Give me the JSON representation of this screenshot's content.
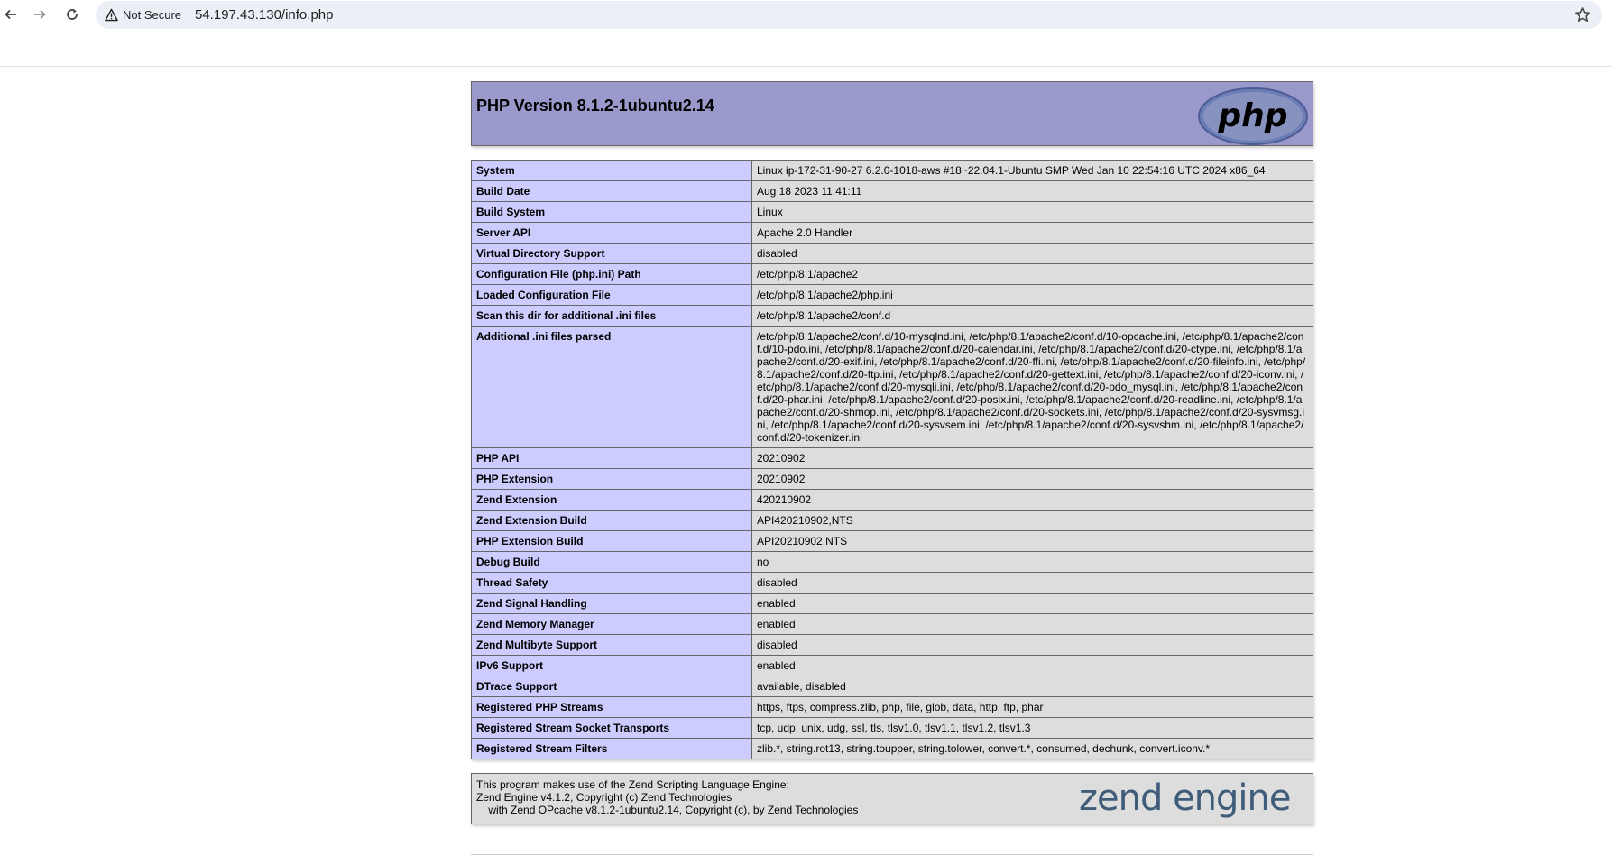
{
  "browser": {
    "security_label": "Not Secure",
    "url": "54.197.43.130/info.php",
    "icons": {
      "back": "arrow-left-icon",
      "forward": "arrow-right-icon",
      "reload": "reload-icon",
      "warning": "warning-triangle-icon",
      "bookmark": "star-icon"
    }
  },
  "header": {
    "title": "PHP Version 8.1.2-1ubuntu2.14",
    "logo_text": "php"
  },
  "info_rows": [
    {
      "label": "System",
      "value": "Linux ip-172-31-90-27 6.2.0-1018-aws #18~22.04.1-Ubuntu SMP Wed Jan 10 22:54:16 UTC 2024 x86_64"
    },
    {
      "label": "Build Date",
      "value": "Aug 18 2023 11:41:11"
    },
    {
      "label": "Build System",
      "value": "Linux"
    },
    {
      "label": "Server API",
      "value": "Apache 2.0 Handler"
    },
    {
      "label": "Virtual Directory Support",
      "value": "disabled"
    },
    {
      "label": "Configuration File (php.ini) Path",
      "value": "/etc/php/8.1/apache2"
    },
    {
      "label": "Loaded Configuration File",
      "value": "/etc/php/8.1/apache2/php.ini"
    },
    {
      "label": "Scan this dir for additional .ini files",
      "value": "/etc/php/8.1/apache2/conf.d"
    },
    {
      "label": "Additional .ini files parsed",
      "value": "/etc/php/8.1/apache2/conf.d/10-mysqlnd.ini, /etc/php/8.1/apache2/conf.d/10-opcache.ini, /etc/php/8.1/apache2/conf.d/10-pdo.ini, /etc/php/8.1/apache2/conf.d/20-calendar.ini, /etc/php/8.1/apache2/conf.d/20-ctype.ini, /etc/php/8.1/apache2/conf.d/20-exif.ini, /etc/php/8.1/apache2/conf.d/20-ffi.ini, /etc/php/8.1/apache2/conf.d/20-fileinfo.ini, /etc/php/8.1/apache2/conf.d/20-ftp.ini, /etc/php/8.1/apache2/conf.d/20-gettext.ini, /etc/php/8.1/apache2/conf.d/20-iconv.ini, /etc/php/8.1/apache2/conf.d/20-mysqli.ini, /etc/php/8.1/apache2/conf.d/20-pdo_mysql.ini, /etc/php/8.1/apache2/conf.d/20-phar.ini, /etc/php/8.1/apache2/conf.d/20-posix.ini, /etc/php/8.1/apache2/conf.d/20-readline.ini, /etc/php/8.1/apache2/conf.d/20-shmop.ini, /etc/php/8.1/apache2/conf.d/20-sockets.ini, /etc/php/8.1/apache2/conf.d/20-sysvmsg.ini, /etc/php/8.1/apache2/conf.d/20-sysvsem.ini, /etc/php/8.1/apache2/conf.d/20-sysvshm.ini, /etc/php/8.1/apache2/conf.d/20-tokenizer.ini"
    },
    {
      "label": "PHP API",
      "value": "20210902"
    },
    {
      "label": "PHP Extension",
      "value": "20210902"
    },
    {
      "label": "Zend Extension",
      "value": "420210902"
    },
    {
      "label": "Zend Extension Build",
      "value": "API420210902,NTS"
    },
    {
      "label": "PHP Extension Build",
      "value": "API20210902,NTS"
    },
    {
      "label": "Debug Build",
      "value": "no"
    },
    {
      "label": "Thread Safety",
      "value": "disabled"
    },
    {
      "label": "Zend Signal Handling",
      "value": "enabled"
    },
    {
      "label": "Zend Memory Manager",
      "value": "enabled"
    },
    {
      "label": "Zend Multibyte Support",
      "value": "disabled"
    },
    {
      "label": "IPv6 Support",
      "value": "enabled"
    },
    {
      "label": "DTrace Support",
      "value": "available, disabled"
    },
    {
      "label": "Registered PHP Streams",
      "value": "https, ftps, compress.zlib, php, file, glob, data, http, ftp, phar"
    },
    {
      "label": "Registered Stream Socket Transports",
      "value": "tcp, udp, unix, udg, ssl, tls, tlsv1.0, tlsv1.1, tlsv1.2, tlsv1.3"
    },
    {
      "label": "Registered Stream Filters",
      "value": "zlib.*, string.rot13, string.toupper, string.tolower, convert.*, consumed, dechunk, convert.iconv.*"
    }
  ],
  "footer": {
    "line1": "This program makes use of the Zend Scripting Language Engine:",
    "line2": "Zend Engine v4.1.2, Copyright (c) Zend Technologies",
    "line3": "    with Zend OPcache v8.1.2-1ubuntu2.14, Copyright (c), by Zend Technologies",
    "logo_text": "zend engine"
  },
  "colors": {
    "header_bg": "#9999cc",
    "label_bg": "#ccccff",
    "value_bg": "#dddddd",
    "border": "#666666"
  }
}
